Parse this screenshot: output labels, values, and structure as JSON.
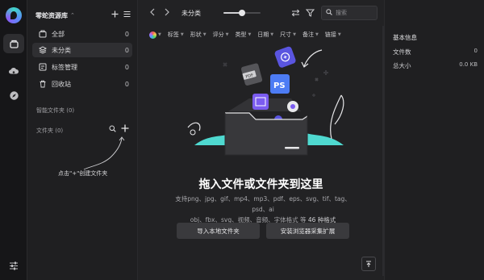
{
  "colors": {
    "accent": "#4d7cf4",
    "teal": "#4fd9d0",
    "bg": "#222224"
  },
  "rail": {
    "icons": [
      "app-logo",
      "library-icon",
      "cloud-icon",
      "compass-icon"
    ],
    "settings_icon": "sliders-icon"
  },
  "sidebar": {
    "library_name": "零蛇资源库",
    "items": [
      {
        "label": "全部",
        "count": "0",
        "icon": "all-files-icon"
      },
      {
        "label": "未分类",
        "count": "0",
        "icon": "uncategorized-icon"
      },
      {
        "label": "标签管理",
        "count": "0",
        "icon": "tag-manage-icon"
      },
      {
        "label": "回收站",
        "count": "0",
        "icon": "trash-icon"
      }
    ],
    "smart_folders": "智能文件夹 (0)",
    "folders": "文件夹 (0)",
    "hint": "点击\"+\"创建文件夹"
  },
  "toolbar": {
    "breadcrumb": "未分类",
    "zoom_level": 0.5,
    "search_placeholder": "搜索"
  },
  "filters": [
    "标签",
    "形状",
    "评分",
    "类型",
    "日期",
    "尺寸",
    "备注",
    "链接"
  ],
  "drop_zone": {
    "title": "拖入文件或文件夹到这里",
    "desc_line1": "支持png、jpg、gif、mp4、mp3、pdf、eps、svg、tif、tag、psd、ai",
    "desc_line2": "obj、fbx、svg、视频、音频、字体格式 等 ",
    "desc_link": "46 种格式",
    "import_button": "导入本地文件夹",
    "extension_button": "安装浏览器采集扩展",
    "badge_ps": "PS",
    "badge_pdf": "PDF"
  },
  "info_panel": {
    "title": "基本信息",
    "rows": [
      {
        "label": "文件数",
        "value": "0"
      },
      {
        "label": "总大小",
        "value": "0.0 KB"
      }
    ]
  }
}
